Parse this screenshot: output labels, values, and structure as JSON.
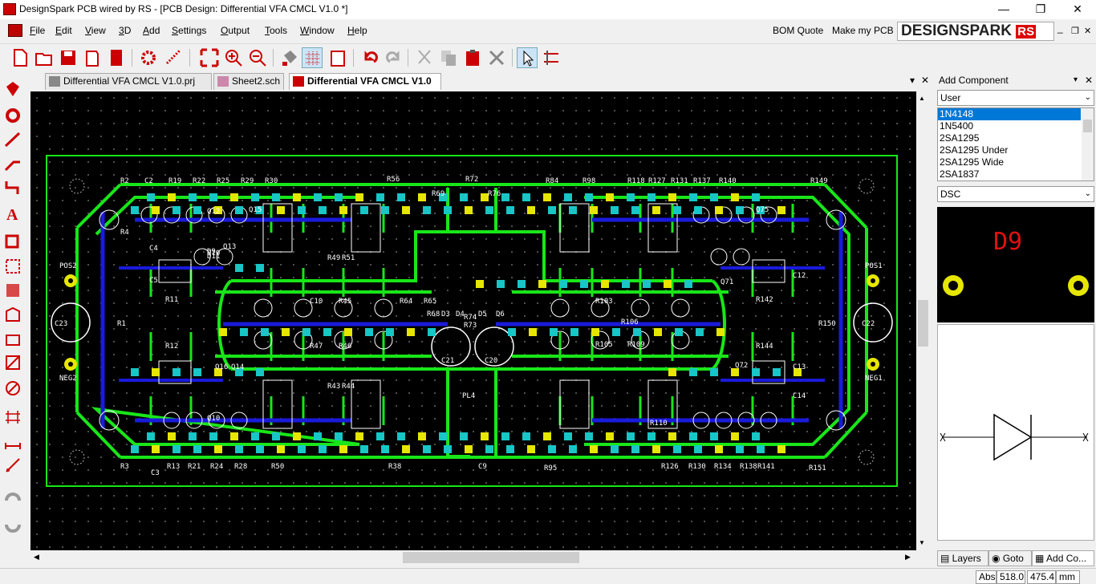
{
  "window": {
    "title": "DesignSpark PCB wired by RS - [PCB Design: Differential VFA CMCL V1.0 *]",
    "minimize": "—",
    "restore": "❐",
    "close": "✕"
  },
  "menu": {
    "items": [
      "File",
      "Edit",
      "View",
      "3D",
      "Add",
      "Settings",
      "Output",
      "Tools",
      "Window",
      "Help"
    ],
    "bom_quote": "BOM Quote",
    "make_my_pcb": "Make my PCB",
    "logo_text": "DESIGNSPARK",
    "logo_sub": "RS",
    "mdi_min": "_",
    "mdi_restore": "❐",
    "mdi_close": "✕"
  },
  "tabs": [
    {
      "label": "Differential VFA CMCL V1.0.prj"
    },
    {
      "label": "Sheet2.sch"
    },
    {
      "label": "Differential VFA CMCL V1.0"
    }
  ],
  "tabs_controls": {
    "dropdown": "▾",
    "close": "✕"
  },
  "pcb_labels": {
    "top_left": [
      "R2",
      "C2",
      "R19",
      "R22",
      "R25",
      "R29",
      "R30"
    ],
    "top_mid": [
      "R72",
      "R69",
      "R76",
      "R56"
    ],
    "top_right": [
      "R84",
      "R98",
      "R118",
      "R127",
      "R131",
      "R137",
      "R140",
      "R149"
    ],
    "left": [
      "POS2",
      "NEG2",
      "C23",
      "R11",
      "R12",
      "C5",
      "C4",
      "C3",
      "R13",
      "R21",
      "R24",
      "R28",
      "R3",
      "Q13",
      "Q14",
      "Q15",
      "Q16",
      "Q10",
      "Q12",
      "D9",
      "D10",
      "D11",
      "R1",
      "R4"
    ],
    "center": [
      "C21",
      "C20",
      "R73",
      "R74",
      "D3",
      "D4",
      "D5",
      "D6",
      "PL4",
      "C9",
      "C10",
      "R45",
      "R47",
      "R46",
      "R49",
      "R43",
      "R44",
      "R51",
      "R50",
      "R38",
      "R64",
      "R65",
      "R68",
      "R103",
      "R105",
      "R109",
      "R106",
      "R95"
    ],
    "right": [
      "POS1",
      "NEG1",
      "C22",
      "R142",
      "R144",
      "R150",
      "C12",
      "C13",
      "C14",
      "R126",
      "R130",
      "R134",
      "R138",
      "R141",
      "R151",
      "Q71",
      "Q72",
      "Q75",
      "R110"
    ]
  },
  "panel": {
    "title": "Add Component",
    "library": "User",
    "components": [
      "1N4148",
      "1N5400",
      "2SA1295",
      "2SA1295 Under",
      "2SA1295 Wide",
      "2SA1837"
    ],
    "selected_index": 0,
    "package": "DSC",
    "preview_label": "D9",
    "tabs": [
      "Layers",
      "Goto",
      "Add Co..."
    ]
  },
  "status": {
    "mode": "Abs",
    "x": "518.0",
    "y": "475.4",
    "units": "mm"
  },
  "colors": {
    "track_green": "#19e619",
    "track_blue": "#1a1adc",
    "pad_yellow": "#e6e600",
    "silk": "#ffffff",
    "pad_cyan": "#18c6c6",
    "preview_label_red": "#e01010"
  }
}
